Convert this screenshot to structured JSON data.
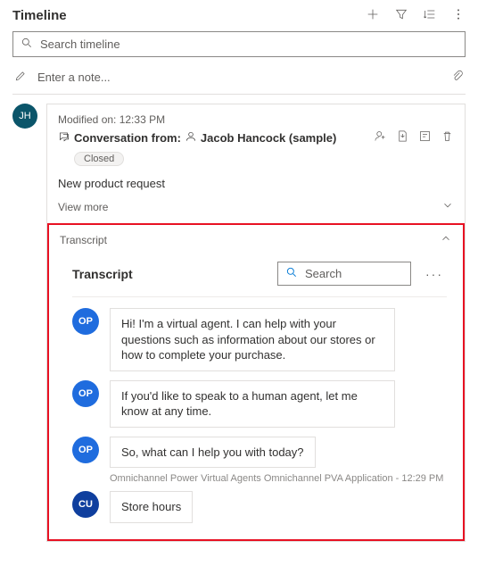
{
  "header": {
    "title": "Timeline"
  },
  "search": {
    "placeholder": "Search timeline"
  },
  "note": {
    "placeholder": "Enter a note..."
  },
  "thread": {
    "avatar": "JH",
    "modified_label": "Modified on: 12:33 PM",
    "conv_prefix": "Conversation from:",
    "conv_name": "Jacob Hancock (sample)",
    "status": "Closed",
    "subject": "New product request",
    "view_more": "View more"
  },
  "transcript": {
    "section_label": "Transcript",
    "title": "Transcript",
    "search_placeholder": "Search",
    "messages": [
      {
        "who": "OP",
        "text": "Hi! I'm a virtual agent. I can help with your questions such as information about our stores or how to complete your purchase."
      },
      {
        "who": "OP",
        "text": "If you'd like to speak to a human agent, let me know at any time."
      },
      {
        "who": "OP",
        "text": "So, what can I help you with today?"
      }
    ],
    "meta": "Omnichannel Power Virtual Agents Omnichannel PVA Application - 12:29 PM",
    "last": {
      "who": "CU",
      "text": "Store hours"
    }
  }
}
